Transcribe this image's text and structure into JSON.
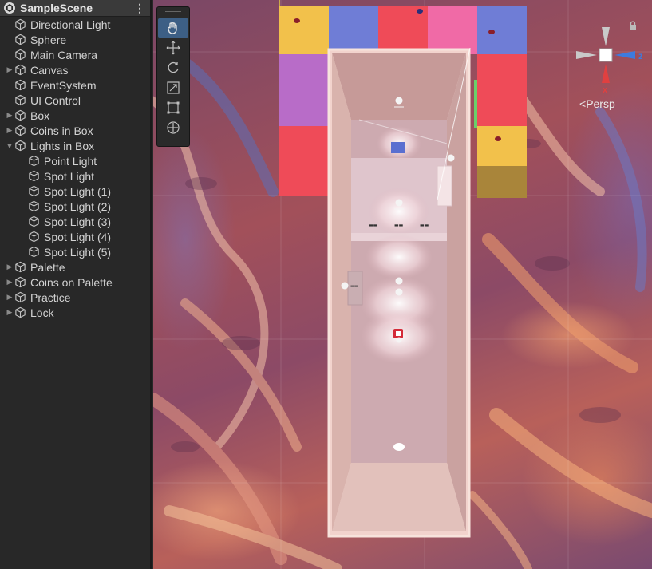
{
  "hierarchy": {
    "scene_name": "SampleScene",
    "menu_glyph": "⋮",
    "items": [
      {
        "label": "Directional Light",
        "depth": 0,
        "expand": "none"
      },
      {
        "label": "Sphere",
        "depth": 0,
        "expand": "none"
      },
      {
        "label": "Main Camera",
        "depth": 0,
        "expand": "none"
      },
      {
        "label": "Canvas",
        "depth": 0,
        "expand": "collapsed"
      },
      {
        "label": "EventSystem",
        "depth": 0,
        "expand": "none"
      },
      {
        "label": "UI Control",
        "depth": 0,
        "expand": "none"
      },
      {
        "label": "Box",
        "depth": 0,
        "expand": "collapsed"
      },
      {
        "label": "Coins in Box",
        "depth": 0,
        "expand": "collapsed"
      },
      {
        "label": "Lights in Box",
        "depth": 0,
        "expand": "expanded"
      },
      {
        "label": "Point Light",
        "depth": 1,
        "expand": "none"
      },
      {
        "label": "Spot Light",
        "depth": 1,
        "expand": "none"
      },
      {
        "label": "Spot Light (1)",
        "depth": 1,
        "expand": "none"
      },
      {
        "label": "Spot Light (2)",
        "depth": 1,
        "expand": "none"
      },
      {
        "label": "Spot Light (3)",
        "depth": 1,
        "expand": "none"
      },
      {
        "label": "Spot Light (4)",
        "depth": 1,
        "expand": "none"
      },
      {
        "label": "Spot Light (5)",
        "depth": 1,
        "expand": "none"
      },
      {
        "label": "Palette",
        "depth": 0,
        "expand": "collapsed"
      },
      {
        "label": "Coins on Palette",
        "depth": 0,
        "expand": "collapsed"
      },
      {
        "label": "Practice",
        "depth": 0,
        "expand": "collapsed"
      },
      {
        "label": "Lock",
        "depth": 0,
        "expand": "collapsed"
      }
    ]
  },
  "scene_view": {
    "projection_label": "Persp",
    "axis_z": "z",
    "axis_x": "x",
    "tools": [
      {
        "name": "hand-tool",
        "active": true
      },
      {
        "name": "move-tool",
        "active": false
      },
      {
        "name": "rotate-tool",
        "active": false
      },
      {
        "name": "scale-tool",
        "active": false
      },
      {
        "name": "rect-tool",
        "active": false
      },
      {
        "name": "transform-tool",
        "active": false
      }
    ],
    "colors": {
      "tool_active": "#3d5f85",
      "axis_x": "#e04040",
      "axis_z": "#3d7bdf",
      "palette_yellow": "#f2c14b",
      "palette_blue": "#6f7dd6",
      "palette_red": "#ef4b58",
      "palette_pink": "#f06aa6",
      "palette_purple": "#b86cc8",
      "box_interior": "#d8b0b4"
    }
  }
}
